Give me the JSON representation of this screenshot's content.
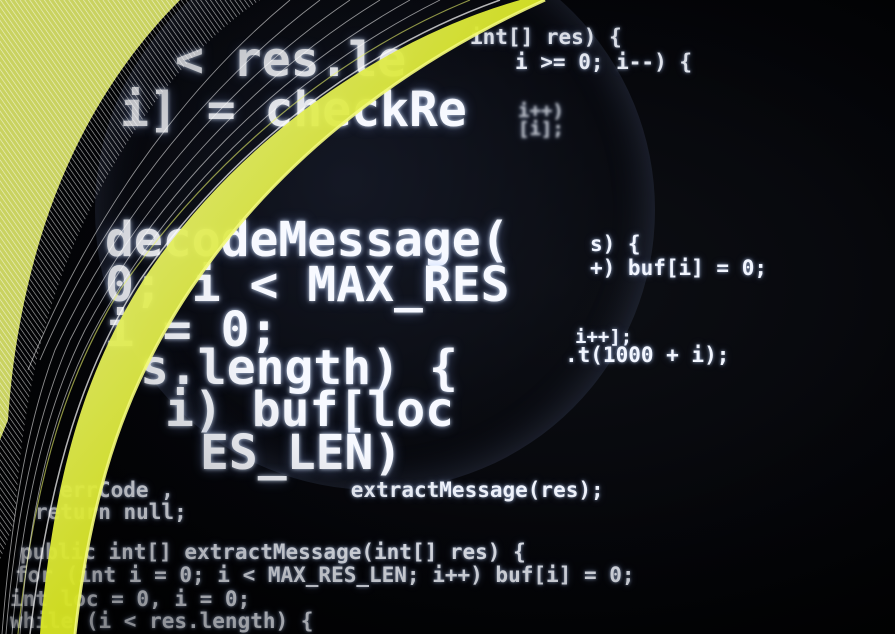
{
  "image": {
    "description_kind": "photo",
    "colors": {
      "background": "#000000",
      "code_text": "#f2f6ff",
      "swoosh_yellow": "#d4e21a",
      "swoosh_light": "#eef7a8",
      "swoosh_white": "#ffffff"
    }
  },
  "code": {
    "big": [
      "< res.le",
      "i] = checkRe",
      "decodeMessage(",
      "0; i < MAX_RES",
      "i = 0;",
      "s.length) {",
      "i) buf[loc",
      "ES_LEN)"
    ],
    "right": [
      "int[] res) {",
      "i >= 0; i--) {",
      "i++)",
      "[i];",
      "s) {",
      "+) buf[i] = 0;",
      "i++];",
      ".t(1000 + i);"
    ],
    "bottom": [
      "errCode ,              extractMessage(res);",
      "return null;",
      "public int[] extractMessage(int[] res) {",
      "for (int i = 0; i < MAX_RES_LEN; i++) buf[i] = 0;",
      "int loc = 0, i = 0;",
      "while (i < res.length) {"
    ]
  }
}
